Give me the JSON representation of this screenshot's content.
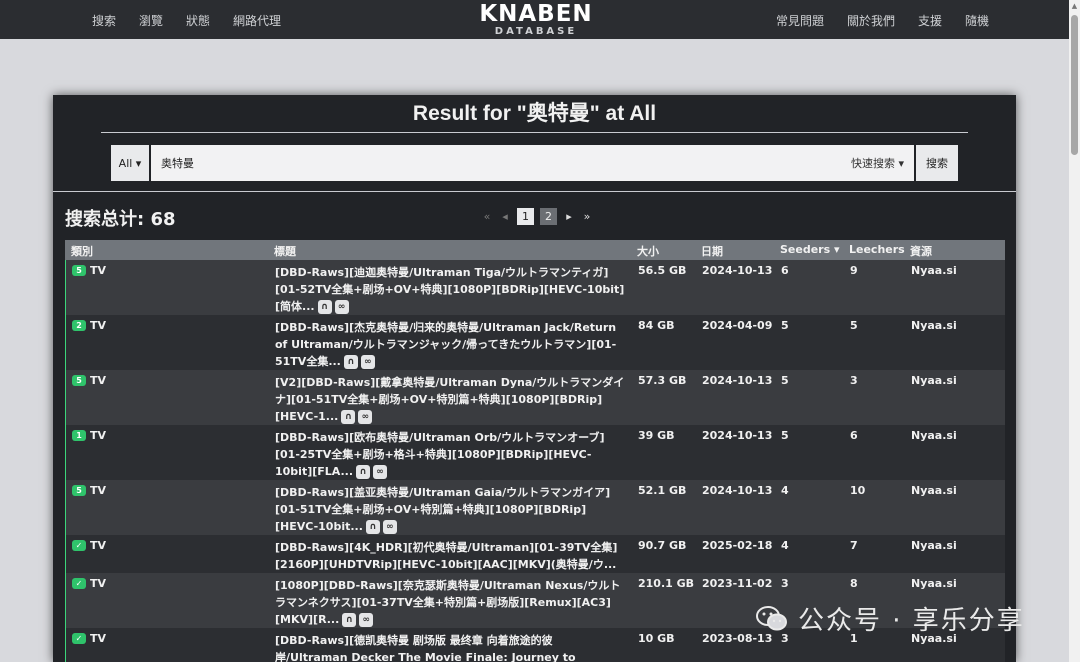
{
  "nav": {
    "left": [
      "搜索",
      "瀏覽",
      "狀態",
      "網路代理"
    ],
    "right": [
      "常見問題",
      "關於我們",
      "支援",
      "隨機"
    ],
    "logo_main": "KNABEN",
    "logo_sub": "DATABASE"
  },
  "search": {
    "title": "Result for \"奥特曼\" at All",
    "category": "All ▾",
    "query": "奥特曼",
    "quick": "快速搜索 ▾",
    "button": "搜索"
  },
  "results": {
    "total_label": "搜索总计: 68",
    "pages": [
      "1",
      "2"
    ],
    "headers": {
      "category": "類別",
      "title": "標題",
      "size": "大小",
      "date": "日期",
      "seeders": "Seeders ▾",
      "leechers": "Leechers",
      "source": "資源"
    },
    "rows": [
      {
        "badge": "5",
        "category": "TV",
        "title": "[DBD-Raws][迪迦奥特曼/Ultraman Tiga/ウルトラマンティガ][01-52TV全集+剧场+OV+特典][1080P][BDRip][HEVC-10bit][简体...",
        "size": "56.5 GB",
        "date": "2024-10-13",
        "seeders": "6",
        "leechers": "9",
        "source": "Nyaa.si"
      },
      {
        "badge": "2",
        "category": "TV",
        "title": "[DBD-Raws][杰克奥特曼/归来的奥特曼/Ultraman Jack/Return of Ultraman/ウルトラマンジャック/帰ってきたウルトラマン][01-51TV全集...",
        "size": "84 GB",
        "date": "2024-04-09",
        "seeders": "5",
        "leechers": "5",
        "source": "Nyaa.si"
      },
      {
        "badge": "5",
        "category": "TV",
        "title": "[V2][DBD-Raws][戴拿奥特曼/Ultraman Dyna/ウルトラマンダイナ][01-51TV全集+剧场+OV+特別篇+特典][1080P][BDRip][HEVC-1...",
        "size": "57.3 GB",
        "date": "2024-10-13",
        "seeders": "5",
        "leechers": "3",
        "source": "Nyaa.si"
      },
      {
        "badge": "1",
        "category": "TV",
        "title": "[DBD-Raws][欧布奥特曼/Ultraman Orb/ウルトラマンオーブ][01-25TV全集+剧场+格斗+特典][1080P][BDRip][HEVC-10bit][FLA...",
        "size": "39 GB",
        "date": "2024-10-13",
        "seeders": "5",
        "leechers": "6",
        "source": "Nyaa.si"
      },
      {
        "badge": "5",
        "category": "TV",
        "title": "[DBD-Raws][盖亚奥特曼/Ultraman Gaia/ウルトラマンガイア][01-51TV全集+剧场+OV+特別篇+特典][1080P][BDRip][HEVC-10bit...",
        "size": "52.1 GB",
        "date": "2024-10-13",
        "seeders": "4",
        "leechers": "10",
        "source": "Nyaa.si"
      },
      {
        "badge": "✓",
        "category": "TV",
        "title": "[DBD-Raws][4K_HDR][初代奥特曼/Ultraman][01-39TV全集][2160P][UHDTVRip][HEVC-10bit][AAC][MKV](奥特曼/ウ...",
        "size": "90.7 GB",
        "date": "2025-02-18",
        "seeders": "4",
        "leechers": "7",
        "source": "Nyaa.si"
      },
      {
        "badge": "✓",
        "category": "TV",
        "title": "[1080P][DBD-Raws][奈克瑟斯奥特曼/Ultraman Nexus/ウルトラマンネクサス][01-37TV全集+特別篇+剧场版][Remux][AC3][MKV][R...",
        "size": "210.1 GB",
        "date": "2023-11-02",
        "seeders": "3",
        "leechers": "8",
        "source": "Nyaa.si"
      },
      {
        "badge": "✓",
        "category": "TV",
        "title": "[DBD-Raws][德凯奥特曼 剧场版 最终章 向着旅途的彼岸/Ultraman Decker The Movie Finale: Journey to Beyond/ウルトラマ...",
        "size": "10 GB",
        "date": "2023-08-13",
        "seeders": "3",
        "leechers": "1",
        "source": "Nyaa.si"
      }
    ]
  },
  "watermark": "公众号 · 享乐分享"
}
